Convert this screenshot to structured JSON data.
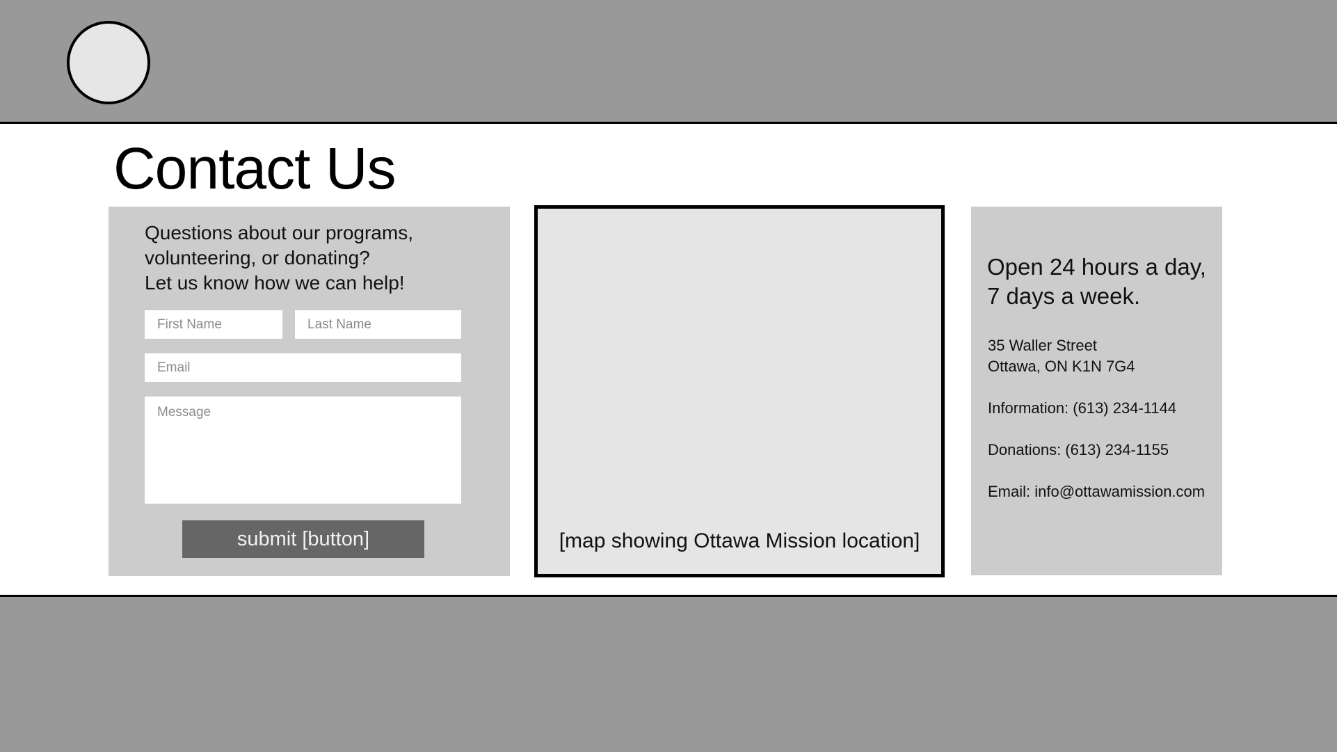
{
  "header": {
    "logo": "circle-logo-placeholder"
  },
  "page_title": "Contact Us",
  "form": {
    "intro_lines": [
      "Questions about our programs,",
      "volunteering, or donating?",
      "Let us know how we can help!"
    ],
    "first_name_placeholder": "First Name",
    "last_name_placeholder": "Last Name",
    "email_placeholder": "Email",
    "message_placeholder": "Message",
    "submit_label": "submit [button]"
  },
  "map": {
    "caption": "[map showing Ottawa Mission location]"
  },
  "info": {
    "hours_lines": [
      "Open 24 hours a day,",
      "7 days a week."
    ],
    "address_line1": "35 Waller Street",
    "address_line2": "Ottawa, ON K1N 7G4",
    "information_phone": "Information: (613) 234-1144",
    "donations_phone": "Donations: (613) 234-1155",
    "email": "Email: info@ottawamission.com"
  },
  "colors": {
    "header_footer_bg": "#999999",
    "panel_bg": "#cccccc",
    "map_bg": "#e5e5e5",
    "button_bg": "#666666",
    "logo_fill": "#e6e6e6"
  }
}
